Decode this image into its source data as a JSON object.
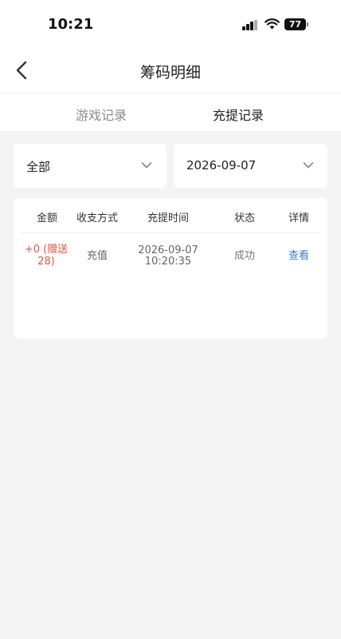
{
  "status_bar": {
    "time": "10:21",
    "battery": "77"
  },
  "nav": {
    "title": "筹码明细"
  },
  "tabs": [
    {
      "label": "游戏记录",
      "active": false
    },
    {
      "label": "充提记录",
      "active": true
    }
  ],
  "filters": {
    "type": {
      "value": "全部"
    },
    "date": {
      "value": "2026-09-07"
    }
  },
  "table": {
    "columns": [
      "金额",
      "收支方式",
      "充提时间",
      "状态",
      "详情"
    ],
    "rows": [
      {
        "amount_line1": "+0 (赠送",
        "amount_line2": "28)",
        "type": "充值",
        "date": "2026-09-07",
        "time": "10:20:35",
        "status": "成功",
        "detail": "查看"
      }
    ]
  },
  "colors": {
    "background": "#f4f4f4",
    "amount": "#e0534a",
    "link": "#3a7be0",
    "tab_inactive": "#8a8a8a"
  }
}
